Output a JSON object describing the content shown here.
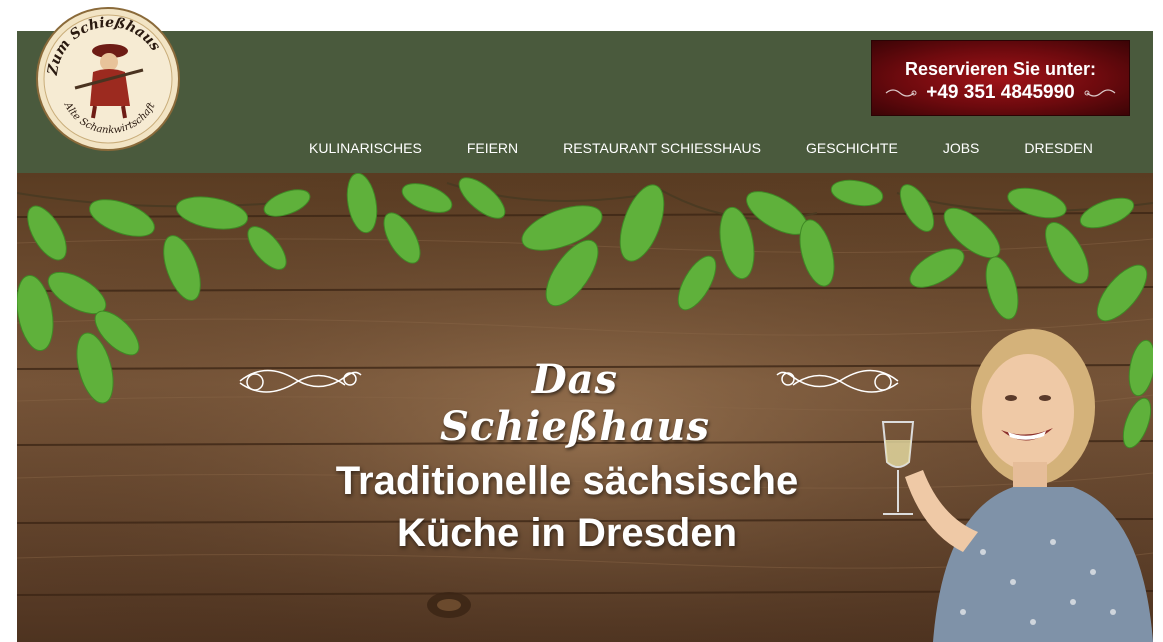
{
  "logo": {
    "top_text": "Zum Schießhaus",
    "bottom_text": "Alte Schankwirtschaft"
  },
  "reservation": {
    "line1": "Reservieren Sie unter:",
    "phone": "+49 351 4845990"
  },
  "nav": {
    "items": [
      {
        "label": "KULINARISCHES"
      },
      {
        "label": "FEIERN"
      },
      {
        "label": "RESTAURANT SCHIESSHAUS"
      },
      {
        "label": "GESCHICHTE"
      },
      {
        "label": "JOBS"
      },
      {
        "label": "DRESDEN"
      }
    ]
  },
  "hero": {
    "title": "Das Schießhaus",
    "subtitle_line1": "Traditionelle sächsische",
    "subtitle_line2": "Küche in Dresden"
  },
  "colors": {
    "header_green": "#4a5a3d",
    "reserve_red": "#8c0f14",
    "wood_brown": "#6b4a2d",
    "leaf_green": "#5fb13b"
  }
}
